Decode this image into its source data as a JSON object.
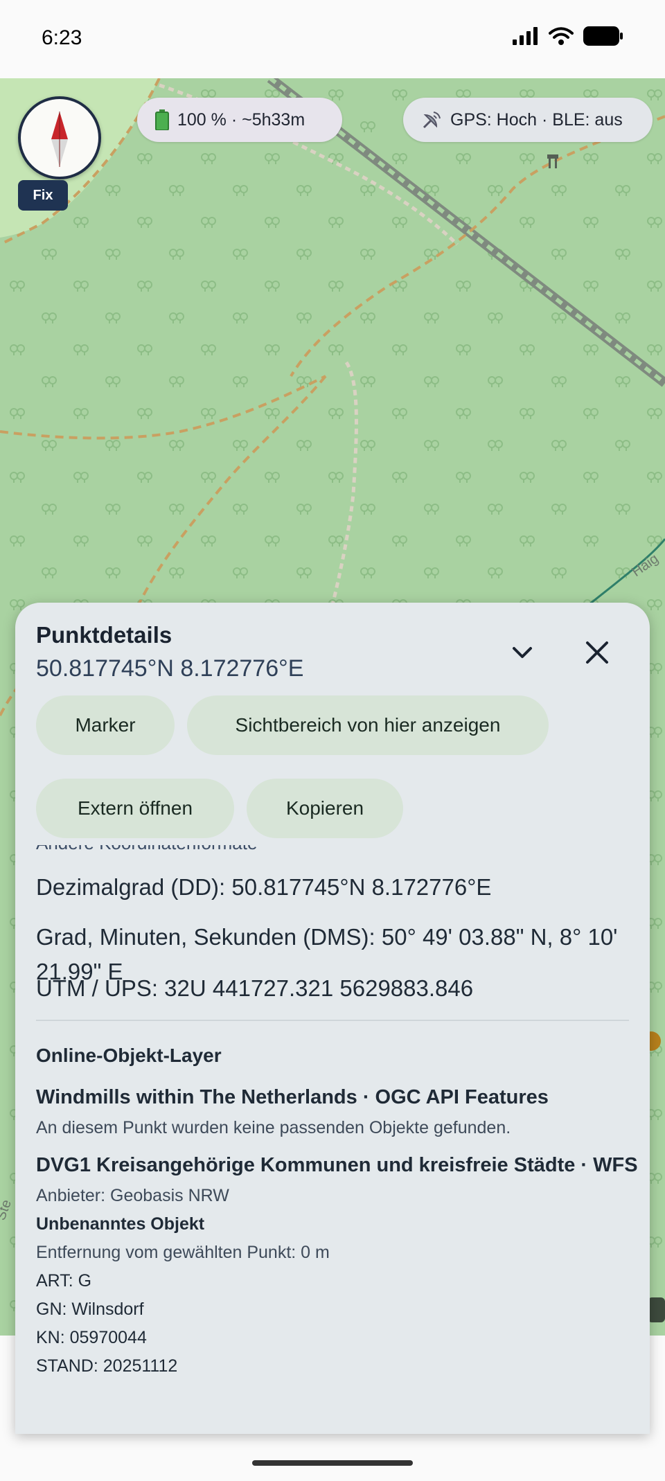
{
  "status_bar": {
    "time": "6:23"
  },
  "map": {
    "road_label": "Haig",
    "left_edge_label": "Ste"
  },
  "compass": {
    "fix_label": "Fix"
  },
  "pills": {
    "battery": "100 % · ~5h33m",
    "gps": "GPS: Hoch · BLE: aus"
  },
  "sheet": {
    "title": "Punktdetails",
    "coords": "50.817745°N 8.172776°E",
    "actions": {
      "marker": "Marker",
      "view": "Sichtbereich von hier anzeigen",
      "extern": "Extern öffnen",
      "copy": "Kopieren"
    },
    "coord_formats": {
      "heading": "Andere Koordinatenformate",
      "dd": "Dezimalgrad (DD): 50.817745°N 8.172776°E",
      "dms": "Grad, Minuten, Sekunden (DMS): 50° 49' 03.88\" N,  8° 10' 21.99\" E",
      "utm": "UTM / UPS: 32U 441727.321 5629883.846"
    },
    "online_layers": {
      "title": "Online-Objekt-Layer",
      "layer1": {
        "title": "Windmills within The Netherlands · OGC API Features",
        "message": "An diesem Punkt wurden keine passenden Objekte gefunden."
      },
      "layer2": {
        "title": "DVG1 Kreisangehörige Kommunen und kreisfreie Städte · WFS",
        "provider": "Anbieter: Geobasis NRW",
        "object_name": "Unbenanntes Objekt",
        "distance": "Entfernung vom gewählten Punkt: 0 m",
        "attrs": [
          "ART: G",
          "GN: Wilnsdorf",
          "KN: 05970044",
          "STAND: 20251112"
        ]
      }
    }
  },
  "colors": {
    "map_forest": "#a9d2a1",
    "map_meadow": "#c5e5b4",
    "track": "#c9a061",
    "sheet_bg": "#e4e9ec",
    "chip_bg": "#d7e4d7",
    "compass_border": "#1f2d45"
  }
}
